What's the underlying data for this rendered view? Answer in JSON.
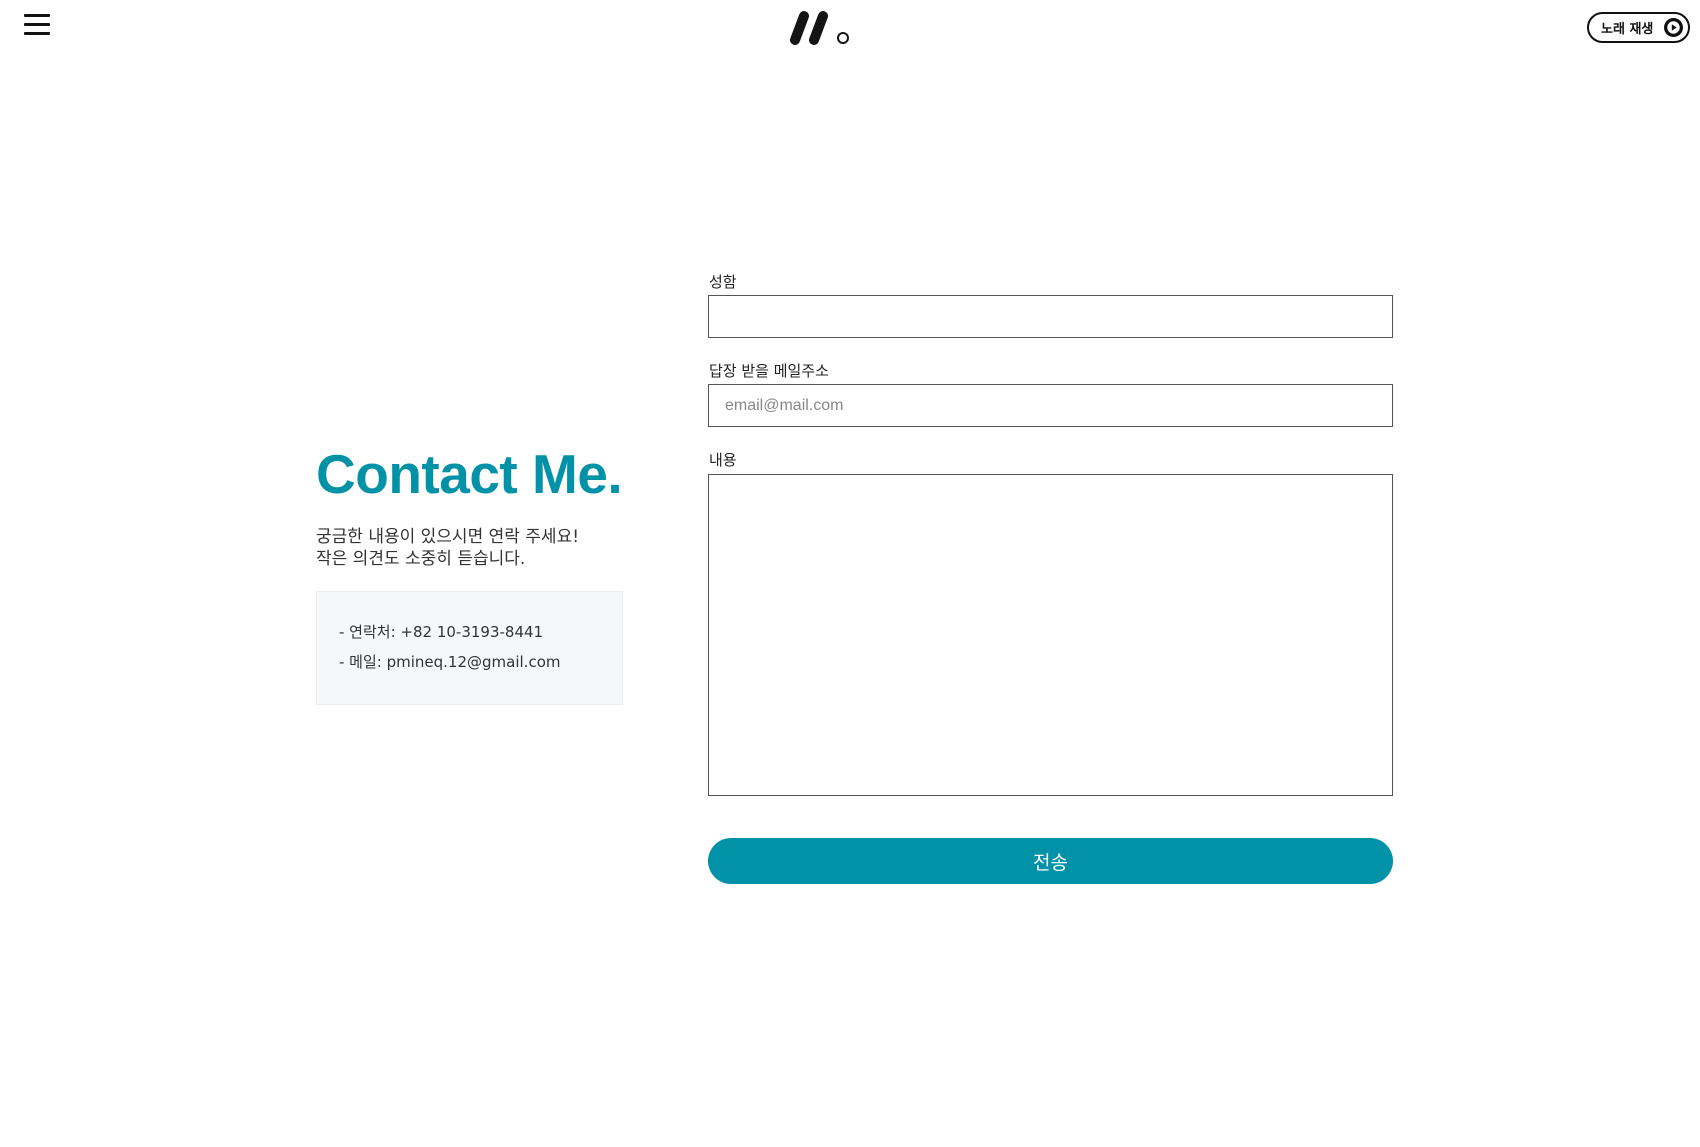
{
  "header": {
    "menu_icon": "hamburger-menu-icon",
    "logo_icon": "brand-logo-icon",
    "music_button": {
      "label": "노래 재생",
      "icon": "play-circle-icon"
    }
  },
  "contact": {
    "title": "Contact Me.",
    "description_line1": "궁금한 내용이 있으시면 연락 주세요!",
    "description_line2": "작은 의견도 소중히 듣습니다.",
    "phone_line": "- 연락처: +82 10-3193-8441",
    "email_line": "- 메일: pmineq.12@gmail.com"
  },
  "form": {
    "name_label": "성함",
    "name_value": "",
    "email_label": "답장 받을 메일주소",
    "email_value": "",
    "email_placeholder": "email@mail.com",
    "message_label": "내용",
    "message_value": "",
    "submit_label": "전송"
  },
  "colors": {
    "accent": "#0292a8",
    "info_box_bg": "#f6f7f8",
    "text": "#222222"
  }
}
